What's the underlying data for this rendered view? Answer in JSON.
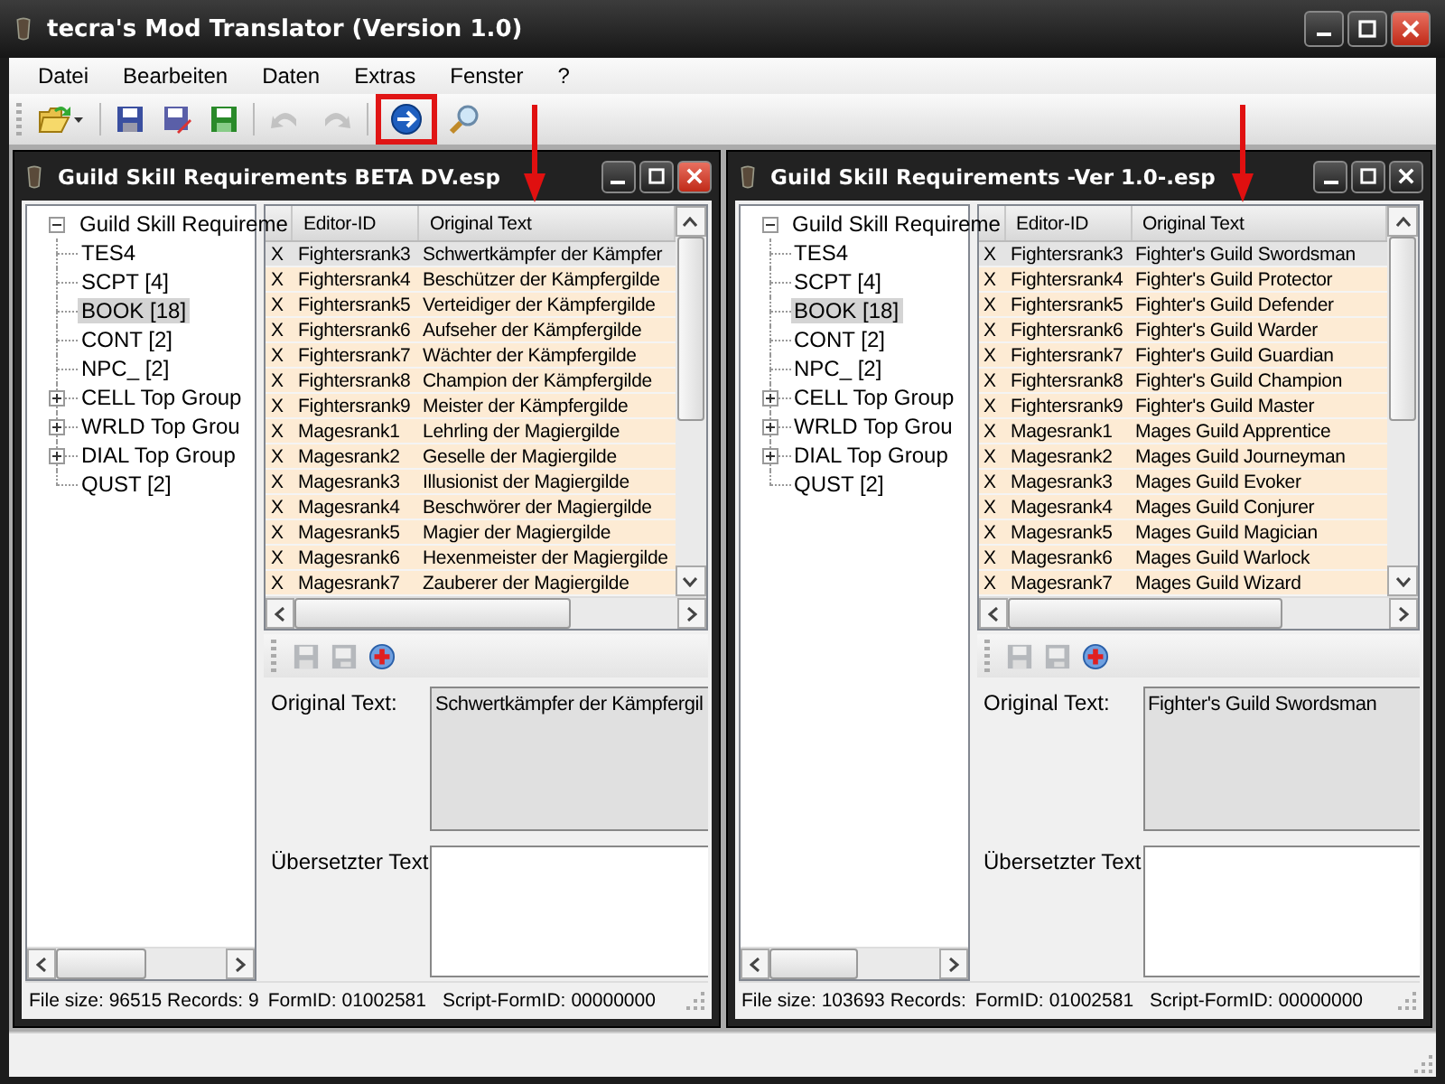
{
  "window": {
    "title": "tecra's Mod Translator (Version 1.0)"
  },
  "menu": [
    "Datei",
    "Bearbeiten",
    "Daten",
    "Extras",
    "Fenster",
    "?"
  ],
  "toolbar": [
    {
      "kind": "open",
      "disabled": false,
      "highlighted": false
    },
    {
      "kind": "save",
      "disabled": false,
      "highlighted": false
    },
    {
      "kind": "save-as",
      "disabled": false,
      "highlighted": false
    },
    {
      "kind": "save-green",
      "disabled": false,
      "highlighted": false
    },
    {
      "kind": "undo",
      "disabled": true,
      "highlighted": false
    },
    {
      "kind": "redo",
      "disabled": true,
      "highlighted": false
    },
    {
      "kind": "go",
      "disabled": false,
      "highlighted": true
    },
    {
      "kind": "search",
      "disabled": false,
      "highlighted": false
    }
  ],
  "documents": [
    {
      "title": "Guild Skill Requirements BETA DV.esp",
      "tree": {
        "label": "Guild Skill Requireme",
        "expanded": true,
        "children": [
          {
            "label": "TES4",
            "kind": "leaf",
            "selected": false
          },
          {
            "label": "SCPT [4]",
            "kind": "leaf",
            "selected": false
          },
          {
            "label": "BOOK [18]",
            "kind": "leaf",
            "selected": true
          },
          {
            "label": "CONT [2]",
            "kind": "leaf",
            "selected": false
          },
          {
            "label": "NPC_ [2]",
            "kind": "leaf",
            "selected": false
          },
          {
            "label": "CELL Top Group",
            "kind": "group",
            "selected": false
          },
          {
            "label": "WRLD Top Grou",
            "kind": "group",
            "selected": false
          },
          {
            "label": "DIAL Top Group",
            "kind": "group",
            "selected": false
          },
          {
            "label": "QUST [2]",
            "kind": "leaf",
            "selected": false
          }
        ]
      },
      "columns": [
        "Editor-ID",
        "Original Text"
      ],
      "rows": [
        {
          "mark": "X",
          "id": "Fightersrank3",
          "text": "Schwertkämpfer der Kämpfer",
          "selected": true
        },
        {
          "mark": "X",
          "id": "Fightersrank4",
          "text": "Beschützer der Kämpfergilde",
          "selected": false
        },
        {
          "mark": "X",
          "id": "Fightersrank5",
          "text": "Verteidiger der Kämpfergilde",
          "selected": false
        },
        {
          "mark": "X",
          "id": "Fightersrank6",
          "text": "Aufseher der Kämpfergilde",
          "selected": false
        },
        {
          "mark": "X",
          "id": "Fightersrank7",
          "text": "Wächter der Kämpfergilde",
          "selected": false
        },
        {
          "mark": "X",
          "id": "Fightersrank8",
          "text": "Champion der Kämpfergilde",
          "selected": false
        },
        {
          "mark": "X",
          "id": "Fightersrank9",
          "text": "Meister der Kämpfergilde",
          "selected": false
        },
        {
          "mark": "X",
          "id": "Magesrank1",
          "text": "Lehrling der Magiergilde",
          "selected": false
        },
        {
          "mark": "X",
          "id": "Magesrank2",
          "text": "Geselle der Magiergilde",
          "selected": false
        },
        {
          "mark": "X",
          "id": "Magesrank3",
          "text": "Illusionist der Magiergilde",
          "selected": false
        },
        {
          "mark": "X",
          "id": "Magesrank4",
          "text": "Beschwörer der Magiergilde",
          "selected": false
        },
        {
          "mark": "X",
          "id": "Magesrank5",
          "text": "Magier der Magiergilde",
          "selected": false
        },
        {
          "mark": "X",
          "id": "Magesrank6",
          "text": "Hexenmeister der Magiergilde",
          "selected": false
        },
        {
          "mark": "X",
          "id": "Magesrank7",
          "text": "Zauberer der Magiergilde",
          "selected": false
        }
      ],
      "original_label": "Original Text:",
      "original_text": "Schwertkämpfer der Kämpfergil",
      "translated_label": "Übersetzter Text",
      "status": [
        "File size: 96515",
        "Records: 9",
        "FormID:",
        "01002581",
        "Script-FormID:",
        "00000000"
      ]
    },
    {
      "title": "Guild Skill Requirements -Ver 1.0-.esp",
      "tree": {
        "label": "Guild Skill Requireme",
        "expanded": true,
        "children": [
          {
            "label": "TES4",
            "kind": "leaf",
            "selected": false
          },
          {
            "label": "SCPT [4]",
            "kind": "leaf",
            "selected": false
          },
          {
            "label": "BOOK [18]",
            "kind": "leaf",
            "selected": true
          },
          {
            "label": "CONT [2]",
            "kind": "leaf",
            "selected": false
          },
          {
            "label": "NPC_ [2]",
            "kind": "leaf",
            "selected": false
          },
          {
            "label": "CELL Top Group",
            "kind": "group",
            "selected": false
          },
          {
            "label": "WRLD Top Grou",
            "kind": "group",
            "selected": false
          },
          {
            "label": "DIAL Top Group",
            "kind": "group",
            "selected": false
          },
          {
            "label": "QUST [2]",
            "kind": "leaf",
            "selected": false
          }
        ]
      },
      "columns": [
        "Editor-ID",
        "Original Text"
      ],
      "rows": [
        {
          "mark": "X",
          "id": "Fightersrank3",
          "text": "Fighter's Guild Swordsman",
          "selected": true
        },
        {
          "mark": "X",
          "id": "Fightersrank4",
          "text": "Fighter's Guild Protector",
          "selected": false
        },
        {
          "mark": "X",
          "id": "Fightersrank5",
          "text": "Fighter's Guild Defender",
          "selected": false
        },
        {
          "mark": "X",
          "id": "Fightersrank6",
          "text": "Fighter's Guild Warder",
          "selected": false
        },
        {
          "mark": "X",
          "id": "Fightersrank7",
          "text": "Fighter's Guild Guardian",
          "selected": false
        },
        {
          "mark": "X",
          "id": "Fightersrank8",
          "text": "Fighter's Guild Champion",
          "selected": false
        },
        {
          "mark": "X",
          "id": "Fightersrank9",
          "text": "Fighter's Guild Master",
          "selected": false
        },
        {
          "mark": "X",
          "id": "Magesrank1",
          "text": "Mages Guild Apprentice",
          "selected": false
        },
        {
          "mark": "X",
          "id": "Magesrank2",
          "text": "Mages Guild Journeyman",
          "selected": false
        },
        {
          "mark": "X",
          "id": "Magesrank3",
          "text": "Mages Guild Evoker",
          "selected": false
        },
        {
          "mark": "X",
          "id": "Magesrank4",
          "text": "Mages Guild Conjurer",
          "selected": false
        },
        {
          "mark": "X",
          "id": "Magesrank5",
          "text": "Mages Guild Magician",
          "selected": false
        },
        {
          "mark": "X",
          "id": "Magesrank6",
          "text": "Mages Guild Warlock",
          "selected": false
        },
        {
          "mark": "X",
          "id": "Magesrank7",
          "text": "Mages Guild Wizard",
          "selected": false
        }
      ],
      "original_label": "Original Text:",
      "original_text": "Fighter's Guild Swordsman",
      "translated_label": "Übersetzter Text",
      "status": [
        "File size: 103693",
        "Records:",
        "FormID:",
        "01002581",
        "Script-FormID:",
        "00000000"
      ]
    }
  ]
}
